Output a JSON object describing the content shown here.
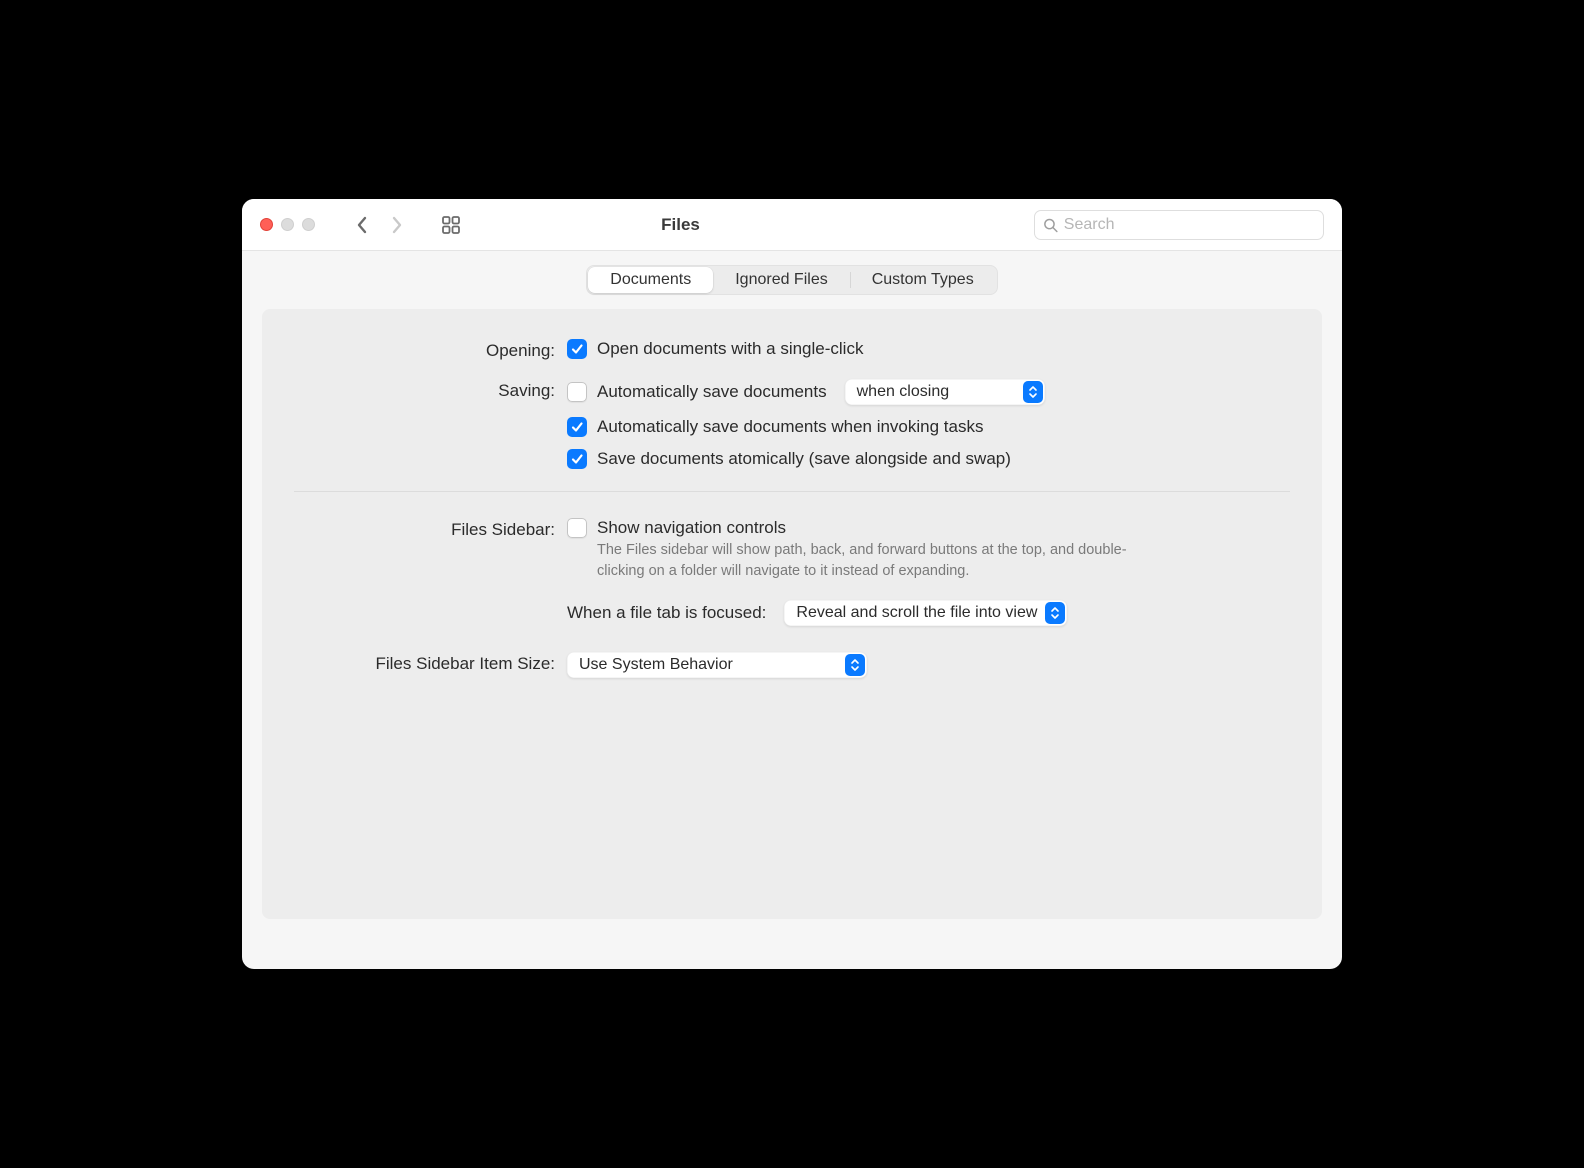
{
  "window": {
    "title": "Files"
  },
  "toolbar": {
    "search_placeholder": "Search"
  },
  "tabs": [
    "Documents",
    "Ignored Files",
    "Custom Types"
  ],
  "sections": {
    "opening": {
      "label": "Opening:",
      "single_click": {
        "checked": true,
        "label": "Open documents with a single-click"
      }
    },
    "saving": {
      "label": "Saving:",
      "auto_on_close": {
        "checked": false,
        "label": "Automatically save documents",
        "when": "when closing"
      },
      "auto_on_tasks": {
        "checked": true,
        "label": "Automatically save documents when invoking tasks"
      },
      "atomic": {
        "checked": true,
        "label": "Save documents atomically (save alongside and swap)"
      }
    },
    "files_sidebar": {
      "label": "Files Sidebar:",
      "show_nav": {
        "checked": false,
        "label": "Show navigation controls"
      },
      "desc": "The Files sidebar will show path, back, and forward buttons at the top, and double-clicking on a folder will navigate to it instead of expanding.",
      "focus_label": "When a file tab is focused:",
      "focus_value": "Reveal and scroll the file into view"
    },
    "item_size": {
      "label": "Files Sidebar Item Size:",
      "value": "Use System Behavior"
    }
  }
}
